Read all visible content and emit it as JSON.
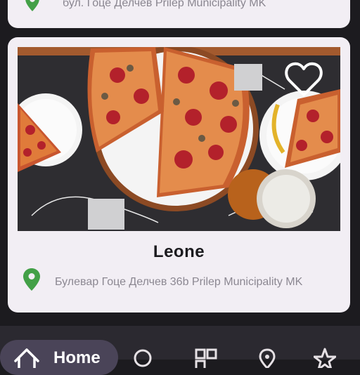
{
  "previous_card": {
    "address": "бул. Гоце Делчев Prilep Municipality MK",
    "pin_color": "#43a047"
  },
  "card": {
    "name": "Leone",
    "address": "Булевар Гоце Делчев 36b Prilep Municipality MK",
    "image_subject": "pizza",
    "favorite": false,
    "pin_color": "#43a047"
  },
  "nav": {
    "items": [
      {
        "label": "Home",
        "icon": "home-icon",
        "active": true
      },
      {
        "label": "",
        "icon": "search-icon",
        "active": false
      },
      {
        "label": "",
        "icon": "qr-code-icon",
        "active": false
      },
      {
        "label": "",
        "icon": "location-icon",
        "active": false
      },
      {
        "label": "",
        "icon": "star-icon",
        "active": false
      }
    ]
  },
  "colors": {
    "background": "#1c1b1f",
    "card": "#f2eef4",
    "accent_pin": "#43a047",
    "nav_active": "#4a4458"
  }
}
